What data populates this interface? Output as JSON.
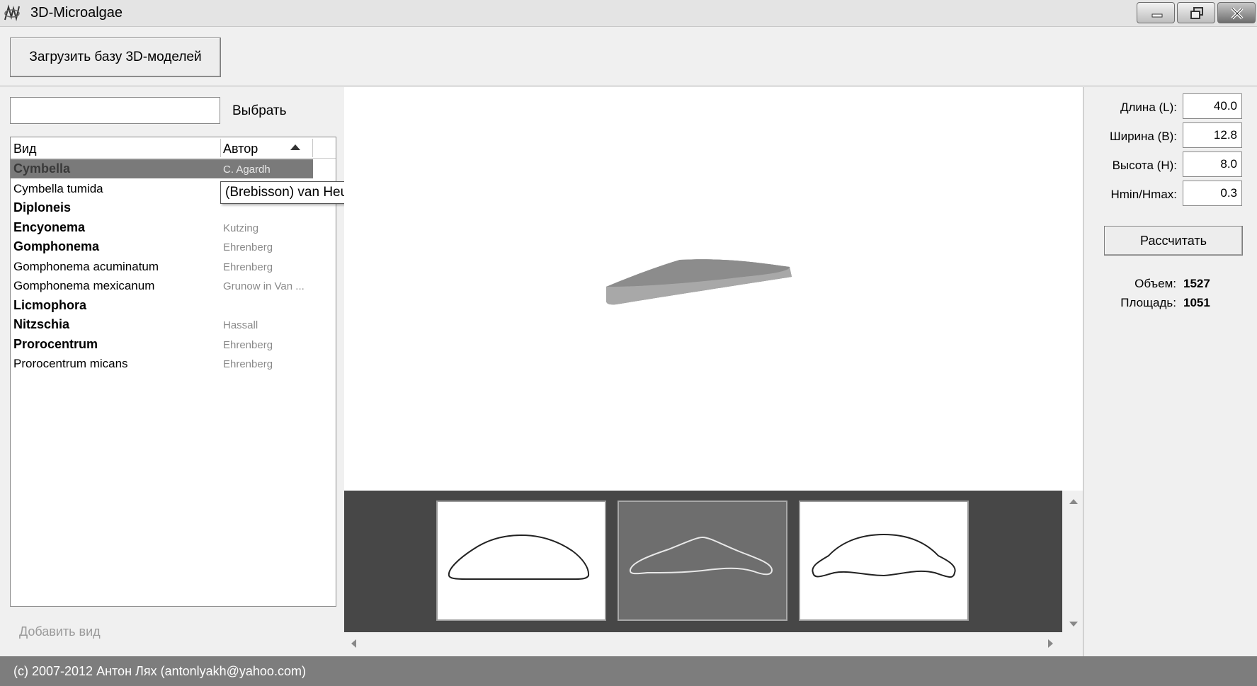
{
  "window": {
    "title": "3D-Microalgae",
    "icon": "algae-app-icon",
    "controls": [
      "minimize-icon",
      "restore-icon",
      "close-icon"
    ]
  },
  "toolbar": {
    "load_button_label": "Загрузить базу 3D-моделей"
  },
  "search": {
    "value": "",
    "select_label": "Выбрать"
  },
  "species_list": {
    "columns": [
      "Вид",
      "Автор"
    ],
    "sort_indicator": "ascending",
    "rows": [
      {
        "species": "Cymbella",
        "author": "C. Agardh",
        "bold": true,
        "selected": true
      },
      {
        "species": "Cymbella tumida",
        "author": "",
        "bold": false,
        "selected": false
      },
      {
        "species": "Diploneis",
        "author": "",
        "bold": true,
        "selected": false
      },
      {
        "species": "Encyonema",
        "author": "Kutzing",
        "bold": true,
        "selected": false
      },
      {
        "species": "Gomphonema",
        "author": "Ehrenberg",
        "bold": true,
        "selected": false
      },
      {
        "species": "Gomphonema acuminatum",
        "author": "Ehrenberg",
        "bold": false,
        "selected": false
      },
      {
        "species": "Gomphonema mexicanum",
        "author": "Grunow in Van ...",
        "bold": false,
        "selected": false
      },
      {
        "species": "Licmophora",
        "author": "",
        "bold": true,
        "selected": false
      },
      {
        "species": "Nitzschia",
        "author": "Hassall",
        "bold": true,
        "selected": false
      },
      {
        "species": "Prorocentrum",
        "author": "Ehrenberg",
        "bold": true,
        "selected": false
      },
      {
        "species": "Prorocentrum micans",
        "author": "Ehrenberg",
        "bold": false,
        "selected": false
      }
    ],
    "tooltip": "(Brebisson) van Heurck",
    "add_label": "Добавить вид"
  },
  "parameters": {
    "length_label": "Длина (L):",
    "length_value": "40.0",
    "width_label": "Ширина (B):",
    "width_value": "12.8",
    "height_label": "Высота (H):",
    "height_value": "8.0",
    "ratio_label": "Hmin/Hmax:",
    "ratio_value": "0.3",
    "calc_button_label": "Рассчитать"
  },
  "results": {
    "volume_label": "Объем:",
    "volume_value": "1527",
    "area_label": "Площадь:",
    "area_value": "1051"
  },
  "gallery": {
    "selected_index": 1,
    "thumbnails": [
      "shape-outline-1",
      "shape-outline-2",
      "shape-outline-3"
    ]
  },
  "status": {
    "copyright": "(c) 2007-2012 Антон Лях (antonlyakh@yahoo.com)"
  },
  "colors": {
    "selected_row": "#7a7a7a",
    "gallery_background": "#474747",
    "status_bar": "#7d7d7d",
    "model_fill": "#8c8c8c"
  }
}
